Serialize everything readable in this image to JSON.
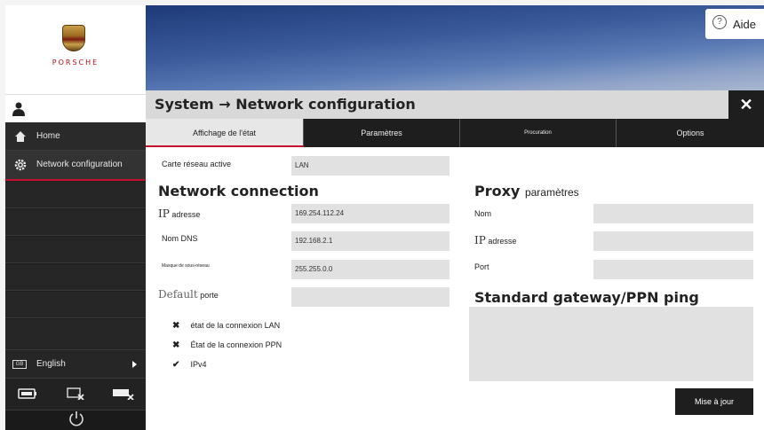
{
  "brand": {
    "logo_text": "PORSCHE"
  },
  "help": {
    "label": "Aide",
    "icon_glyph": "?"
  },
  "title": {
    "text": "System → Network configuration",
    "close_glyph": "✕"
  },
  "sidebar": {
    "items": [
      {
        "label": "Home",
        "icon": "home-icon"
      },
      {
        "label": "Network configuration",
        "icon": "gear-icon"
      }
    ],
    "language": {
      "label": "English",
      "flag_text": "GB"
    },
    "power_text": ""
  },
  "tabs": [
    {
      "label": "Affichage de l'état",
      "active": true
    },
    {
      "label": "Paramètres",
      "active": false
    },
    {
      "label": "Procuration",
      "active": false
    },
    {
      "label": "Options",
      "active": false
    }
  ],
  "network": {
    "active_card_label": "Carte réseau active",
    "active_card_value": "LAN",
    "section_title": "Network connection",
    "ip_prefix": "IP",
    "ip_label": "adresse",
    "ip_value": "169.254.112.24",
    "dns_label": "Nom DNS",
    "dns_value": "192.168.2.1",
    "mask_label": "Masque de sous-réseau",
    "mask_value": "255.255.0.0",
    "gateway_prefix": "Default",
    "gateway_label": "porte",
    "gateway_value": ""
  },
  "status": [
    {
      "mark": "✖",
      "label": "état de la connexion LAN"
    },
    {
      "mark": "✖",
      "label": "État de la connexion PPN"
    },
    {
      "mark": "✔",
      "label": "IPv4"
    }
  ],
  "proxy": {
    "title": "Proxy",
    "title_suffix": "paramètres",
    "name_label": "Nom",
    "ip_prefix": "IP",
    "ip_label": "adresse",
    "port_label": "Port"
  },
  "ping": {
    "title": "Standard gateway/PPN ping"
  },
  "update_button": "Mise à jour",
  "colors": {
    "accent": "#c8102e",
    "dark": "#1e1e1e",
    "field": "#e1e1e1"
  }
}
